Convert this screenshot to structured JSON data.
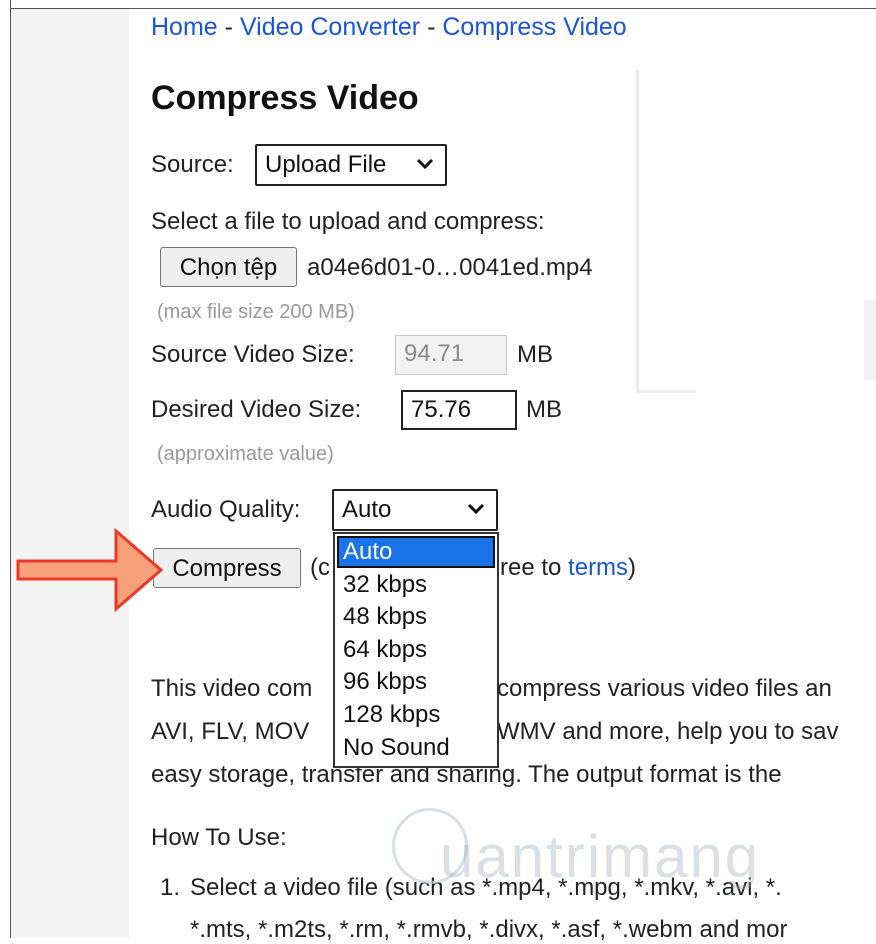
{
  "breadcrumb": {
    "home": "Home",
    "sep1": "-",
    "video_converter": "Video Converter",
    "sep2": "-",
    "current": "Compress Video"
  },
  "page_title": "Compress Video",
  "source": {
    "label": "Source:",
    "selected": "Upload File"
  },
  "upload": {
    "prompt": "Select a file to upload and compress:",
    "choose_button": "Chọn tệp",
    "file_name": "a04e6d01-0…0041ed.mp4",
    "max_size_hint": "(max file size 200 MB)"
  },
  "source_size": {
    "label": "Source Video Size:",
    "value": "94.71",
    "unit": "MB"
  },
  "desired_size": {
    "label": "Desired Video Size:",
    "value": "75.76",
    "unit": "MB",
    "hint": "(approximate value)"
  },
  "audio": {
    "label": "Audio Quality:",
    "selected": "Auto",
    "options": [
      "Auto",
      "32 kbps",
      "48 kbps",
      "64 kbps",
      "96 kbps",
      "128 kbps",
      "No Sound"
    ]
  },
  "compress": {
    "button": "Compress",
    "terms_prefix": "(c",
    "terms_middle": "ree to",
    "terms_link": "terms",
    "terms_suffix": ")"
  },
  "description": {
    "line1_a": "This video com",
    "line1_b": "compress various video files an",
    "line2_a": "AVI, FLV, MOV",
    "line2_b": "WMV and more, help you to sav",
    "line3": "easy storage, transfer and sharing. The output format is the"
  },
  "how_to": {
    "heading": "How To Use:",
    "item1_number": "1.",
    "item1_line1": "Select a video file (such as *.mp4, *.mpg, *.mkv, *.avi, *.",
    "item1_line2": "*.mts, *.m2ts, *.rm, *.rmvb, *.divx, *.asf, *.webm and mor"
  },
  "watermark": "uantrimang",
  "colors": {
    "link": "#1a56d6",
    "selected_option": "#1a73e8",
    "arrow_fill": "#f7a07a",
    "arrow_stroke": "#e83a26"
  }
}
